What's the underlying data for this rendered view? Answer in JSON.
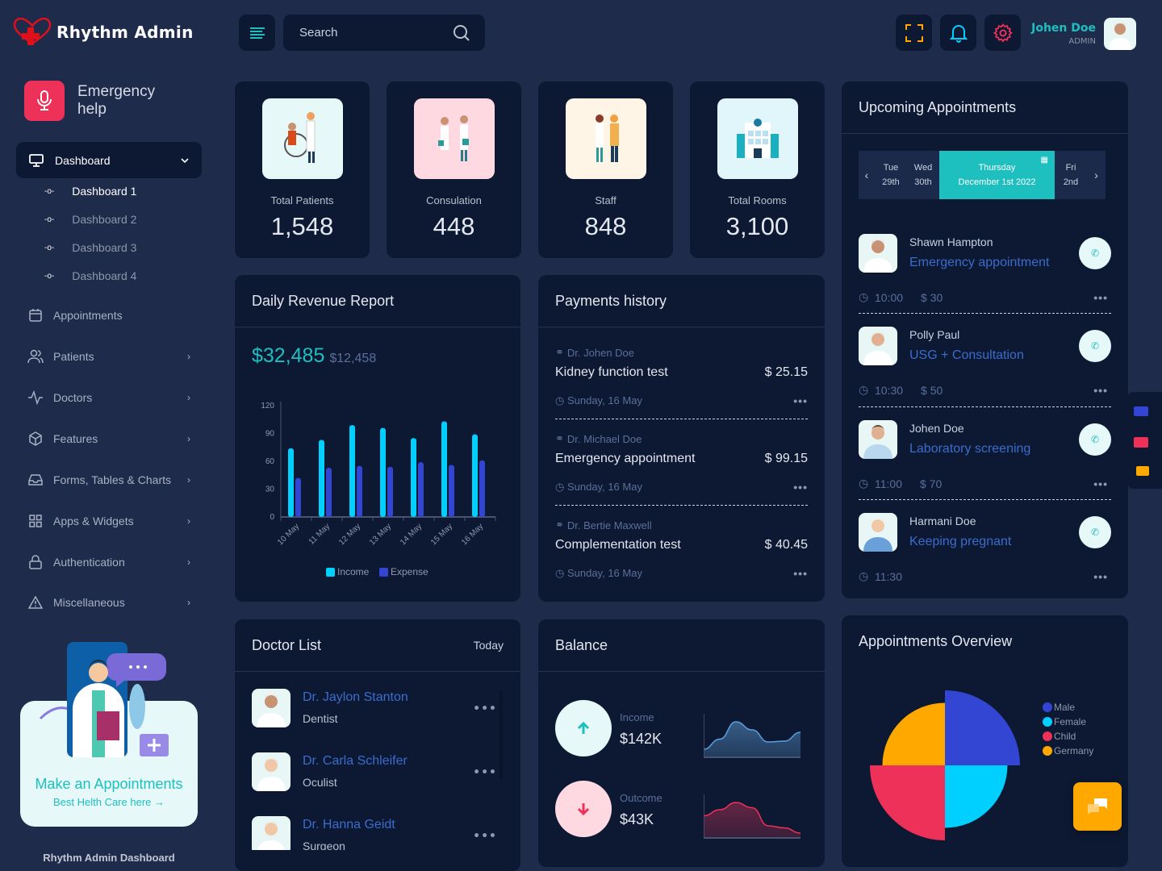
{
  "header": {
    "app_title": "Rhythm Admin",
    "search_placeholder": "Search",
    "user": {
      "name": "Johen Doe",
      "role": "ADMIN"
    },
    "icons": [
      "menu-icon",
      "search-icon",
      "fullscreen-icon",
      "bell-icon",
      "gear-icon"
    ]
  },
  "sidebar": {
    "emergency": {
      "line1": "Emergency",
      "line2": "help"
    },
    "active": {
      "label": "Dashboard"
    },
    "sub_items": [
      {
        "label": "Dashboard 1",
        "active": true
      },
      {
        "label": "Dashboard 2"
      },
      {
        "label": "Dashboard 3"
      },
      {
        "label": "Dashboard 4"
      }
    ],
    "items": [
      {
        "label": "Appointments",
        "icon": "calendar-icon",
        "has_children": false
      },
      {
        "label": "Patients",
        "icon": "users-icon",
        "has_children": true
      },
      {
        "label": "Doctors",
        "icon": "activity-icon",
        "has_children": true
      },
      {
        "label": "Features",
        "icon": "box-icon",
        "has_children": true
      },
      {
        "label": "Forms, Tables & Charts",
        "icon": "inbox-icon",
        "has_children": true
      },
      {
        "label": "Apps & Widgets",
        "icon": "grid-icon",
        "has_children": true
      },
      {
        "label": "Authentication",
        "icon": "lock-icon",
        "has_children": true
      },
      {
        "label": "Miscellaneous",
        "icon": "alert-triangle-icon",
        "has_children": true
      }
    ],
    "promo": {
      "title": "Make an Appointments",
      "subtitle": "Best Helth Care here →"
    },
    "footer": "Rhythm Admin Dashboard"
  },
  "stats": [
    {
      "label": "Total Patients",
      "value": "1,548",
      "bg": "#e6f8f8"
    },
    {
      "label": "Consulation",
      "value": "448",
      "bg": "#ffd9e2"
    },
    {
      "label": "Staff",
      "value": "848",
      "bg": "#fff5e6"
    },
    {
      "label": "Total Rooms",
      "value": "3,100",
      "bg": "#e0f6fb"
    }
  ],
  "revenue": {
    "title": "Daily Revenue Report",
    "main_value": "$32,485",
    "secondary_value": "$12,458"
  },
  "payments": {
    "title": "Payments history",
    "items": [
      {
        "doctor": "Dr. Johen Doe",
        "name": "Kidney function test",
        "amount": "$ 25.15",
        "date": "Sunday, 16 May"
      },
      {
        "doctor": "Dr. Michael Doe",
        "name": "Emergency appointment",
        "amount": "$ 99.15",
        "date": "Sunday, 16 May"
      },
      {
        "doctor": "Dr. Bertie Maxwell",
        "name": "Complementation test",
        "amount": "$ 40.45",
        "date": "Sunday, 16 May"
      }
    ]
  },
  "appointments": {
    "title": "Upcoming Appointments",
    "dates": [
      {
        "day": "Tue",
        "date": "29th"
      },
      {
        "day": "Wed",
        "date": "30th"
      },
      {
        "day": "Thursday",
        "date": "December 1st 2022",
        "selected": true
      },
      {
        "day": "Fri",
        "date": "2nd"
      }
    ],
    "items": [
      {
        "name": "Shawn Hampton",
        "type": "Emergency appointment",
        "time": "10:00",
        "price": "$ 30"
      },
      {
        "name": "Polly Paul",
        "type": "USG + Consultation",
        "time": "10:30",
        "price": "$ 50"
      },
      {
        "name": "Johen Doe",
        "type": "Laboratory screening",
        "time": "11:00",
        "price": "$ 70"
      },
      {
        "name": "Harmani Doe",
        "type": "Keeping pregnant",
        "time": "11:30",
        "price": ""
      }
    ]
  },
  "doctors": {
    "title": "Doctor List",
    "filter": "Today",
    "items": [
      {
        "name": "Dr. Jaylon Stanton",
        "specialty": "Dentist"
      },
      {
        "name": "Dr. Carla Schleifer",
        "specialty": "Oculist"
      },
      {
        "name": "Dr. Hanna Geidt",
        "specialty": "Surgeon"
      }
    ]
  },
  "balance": {
    "title": "Balance",
    "income": {
      "label": "Income",
      "value": "$142K",
      "trend": [
        20,
        45,
        88,
        68,
        38,
        40,
        62
      ]
    },
    "outcome": {
      "label": "Outcome",
      "value": "$43K",
      "trend": [
        55,
        70,
        88,
        75,
        30,
        25,
        12
      ]
    }
  },
  "overview": {
    "title": "Appointments Overview"
  },
  "colors": {
    "accent": "#1ebfbf",
    "income": "#00d0ff",
    "expense": "#3246d3",
    "danger": "#ee3158",
    "warning": "#ffa800",
    "card": "#0d1933",
    "page": "#1e2b4a"
  },
  "chart_data": [
    {
      "type": "bar",
      "title": "Daily Revenue Report",
      "categories": [
        "10 May",
        "11 May",
        "12 May",
        "13 May",
        "14 May",
        "15 May",
        "16 May"
      ],
      "series": [
        {
          "name": "Income",
          "color": "#00d0ff",
          "values": [
            74,
            83,
            99,
            96,
            85,
            103,
            89
          ]
        },
        {
          "name": "Expense",
          "color": "#3246d3",
          "values": [
            42,
            53,
            55,
            54,
            59,
            56,
            61
          ]
        }
      ],
      "yticks": [
        0,
        30,
        60,
        90,
        120
      ],
      "ylim": [
        0,
        120
      ],
      "xlabel": "",
      "ylabel": "",
      "legend": "bottom",
      "grid": false
    },
    {
      "type": "pie",
      "subtype": "polar-area",
      "title": "Appointments Overview",
      "labels": [
        "Male",
        "Female",
        "Child",
        "Germany"
      ],
      "values": [
        60,
        50,
        60,
        50
      ],
      "colors": [
        "#3246d3",
        "#00d0ff",
        "#ee3158",
        "#ffa800"
      ],
      "legend": "right"
    }
  ]
}
